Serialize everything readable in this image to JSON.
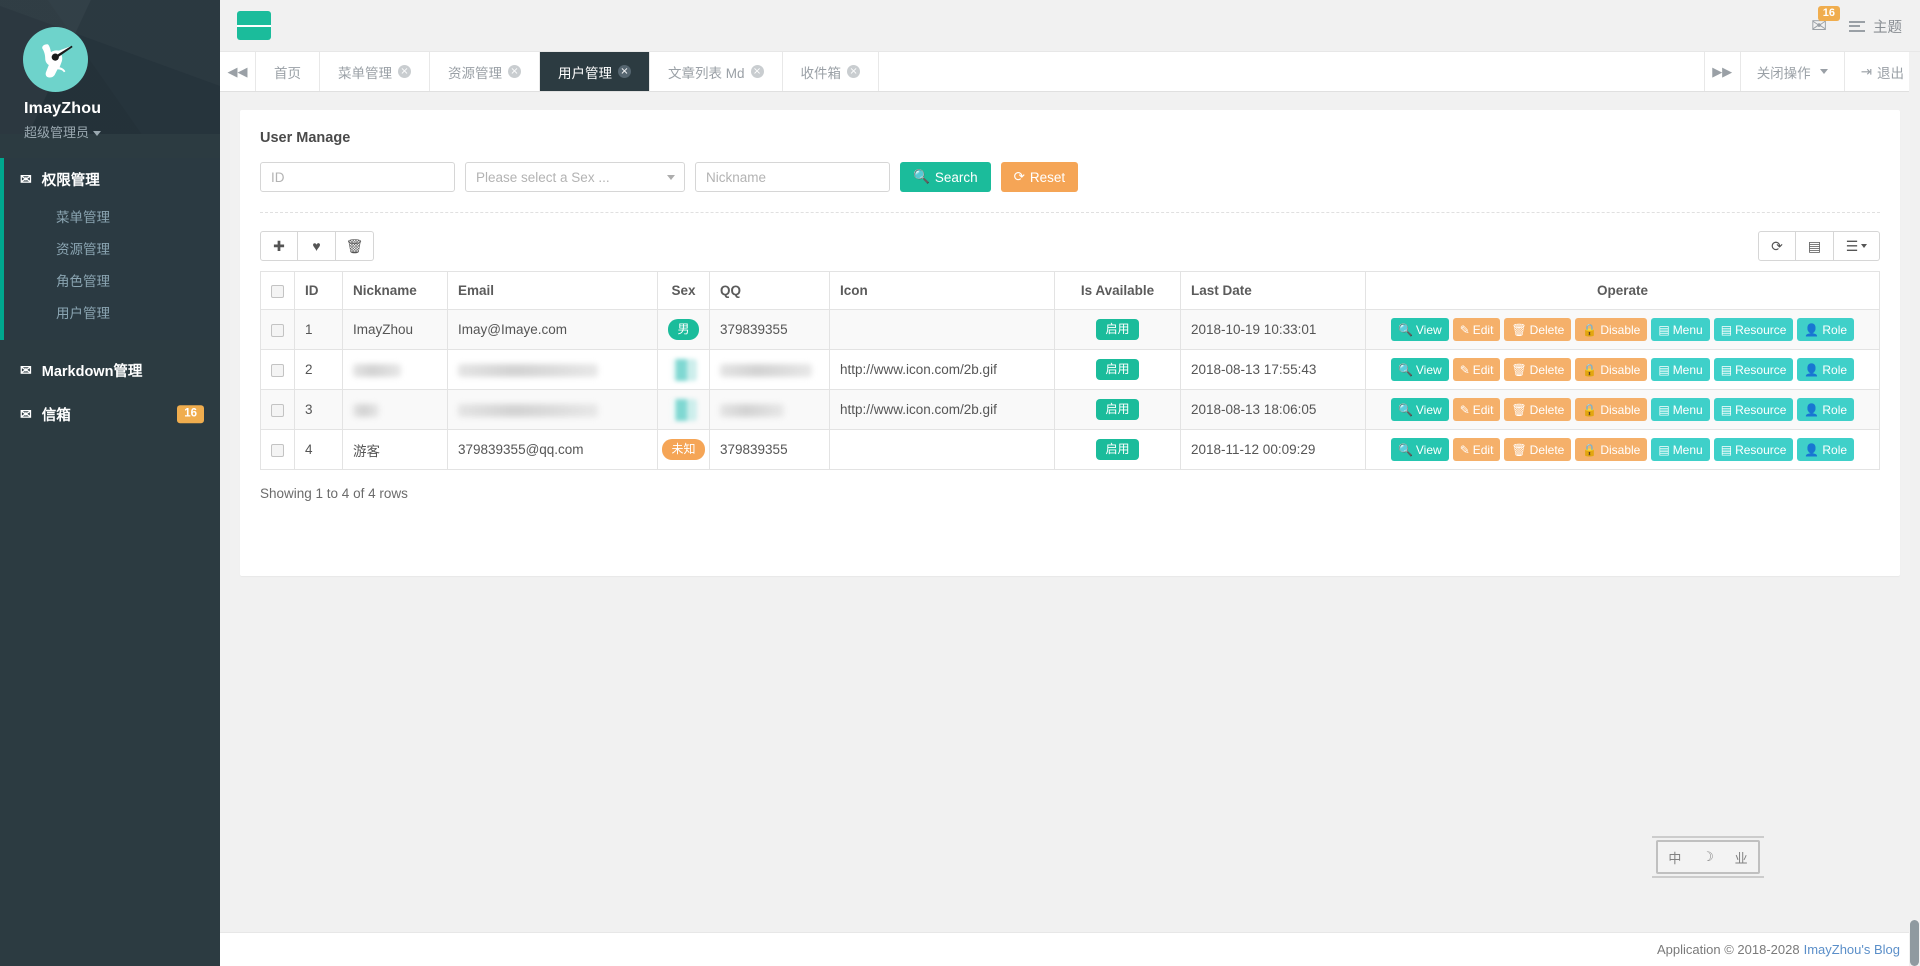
{
  "sidebar": {
    "user": {
      "name": "ImayZhou",
      "role": "超级管理员"
    },
    "sections": [
      {
        "icon": "envelope-icon",
        "label": "权限管理",
        "items": [
          {
            "label": "菜单管理"
          },
          {
            "label": "资源管理"
          },
          {
            "label": "角色管理"
          },
          {
            "label": "用户管理"
          }
        ]
      }
    ],
    "plain_items": [
      {
        "icon": "envelope-icon",
        "label": "Markdown管理",
        "badge": ""
      },
      {
        "icon": "envelope-icon",
        "label": "信箱",
        "badge": "16"
      }
    ]
  },
  "topbar": {
    "menu_toggle": "hamburger-icon",
    "mail_badge": "16",
    "theme_label": "主题"
  },
  "tabbar": {
    "scroll_left": "◀◀",
    "scroll_right": "▶▶",
    "tabs": [
      {
        "label": "首页",
        "closable": false,
        "active": false
      },
      {
        "label": "菜单管理",
        "closable": true,
        "active": false
      },
      {
        "label": "资源管理",
        "closable": true,
        "active": false
      },
      {
        "label": "用户管理",
        "closable": true,
        "active": true
      },
      {
        "label": "文章列表 Md",
        "closable": true,
        "active": false
      },
      {
        "label": "收件箱",
        "closable": true,
        "active": false
      }
    ],
    "close_ops_label": "关闭操作",
    "logout_label": "退出"
  },
  "panel": {
    "title": "User Manage",
    "search": {
      "id_placeholder": "ID",
      "id_value": "",
      "sex_selected": "Please select a Sex ...",
      "nickname_placeholder": "Nickname",
      "nickname_value": "",
      "search_label": "Search",
      "reset_label": "Reset"
    },
    "toolbar_left": [
      {
        "icon": "plus-icon",
        "glyph": "✚",
        "name": "add-button"
      },
      {
        "icon": "heart-icon",
        "glyph": "♥",
        "name": "favorite-button"
      },
      {
        "icon": "trash-icon",
        "glyph": "🗑",
        "name": "delete-button"
      }
    ],
    "toolbar_right": [
      {
        "icon": "refresh-icon",
        "glyph": "⟳",
        "name": "refresh-button"
      },
      {
        "icon": "list-view-icon",
        "glyph": "▤",
        "name": "toggle-view-button"
      },
      {
        "icon": "columns-icon",
        "glyph": "☰",
        "name": "columns-button"
      }
    ],
    "columns": [
      "",
      "ID",
      "Nickname",
      "Email",
      "Sex",
      "QQ",
      "Icon",
      "Is Available",
      "Last Date",
      "Operate"
    ],
    "rows": [
      {
        "id": "1",
        "nickname": "ImayZhou",
        "nickname_redacted": false,
        "email": "Imay@Imaye.com",
        "email_redacted": false,
        "sex": "男",
        "sex_redacted": false,
        "qq": "379839355",
        "qq_redacted": false,
        "icon": "",
        "available": "启用",
        "last_date": "2018-10-19 10:33:01"
      },
      {
        "id": "2",
        "nickname": "",
        "nickname_redacted": true,
        "email": "",
        "email_redacted": true,
        "sex": "",
        "sex_redacted": true,
        "qq": "",
        "qq_redacted": true,
        "icon": "http://www.icon.com/2b.gif",
        "available": "启用",
        "last_date": "2018-08-13 17:55:43"
      },
      {
        "id": "3",
        "nickname": "",
        "nickname_redacted": true,
        "email": "",
        "email_redacted": true,
        "sex": "",
        "sex_redacted": true,
        "qq": "",
        "qq_redacted": true,
        "icon": "http://www.icon.com/2b.gif",
        "available": "启用",
        "last_date": "2018-08-13 18:06:05"
      },
      {
        "id": "4",
        "nickname": "游客",
        "nickname_redacted": false,
        "email": "379839355@qq.com",
        "email_redacted": false,
        "sex": "未知",
        "sex_redacted": false,
        "qq": "379839355",
        "qq_redacted": false,
        "icon": "",
        "available": "启用",
        "last_date": "2018-11-12 00:09:29"
      }
    ],
    "operate_buttons": [
      {
        "label": "View",
        "icon": "search-icon",
        "glyph": "🔍",
        "style": "op-teal"
      },
      {
        "label": "Edit",
        "icon": "pencil-icon",
        "glyph": "✎",
        "style": "op-orange"
      },
      {
        "label": "Delete",
        "icon": "trash-icon",
        "glyph": "🗑",
        "style": "op-orange"
      },
      {
        "label": "Disable",
        "icon": "lock-icon",
        "glyph": "🔒",
        "style": "op-orange"
      },
      {
        "label": "Menu",
        "icon": "id-card-icon",
        "glyph": "▤",
        "style": "op-cyan"
      },
      {
        "label": "Resource",
        "icon": "id-card-icon",
        "glyph": "▤",
        "style": "op-cyan"
      },
      {
        "label": "Role",
        "icon": "user-icon",
        "glyph": "👤",
        "style": "op-cyan"
      }
    ],
    "showing": "Showing 1 to 4 of 4 rows"
  },
  "ime": {
    "mode": "中",
    "shape": "☽",
    "extra": "业"
  },
  "footer": {
    "text": "Application © 2018-2028",
    "link": "ImayZhou's Blog"
  },
  "colors": {
    "accent_green": "#1bbc9b",
    "accent_orange": "#f5a556",
    "sidebar_bg": "#2c3b41",
    "sidebar_dark": "#26343c",
    "cyan": "#3fd0c9"
  }
}
